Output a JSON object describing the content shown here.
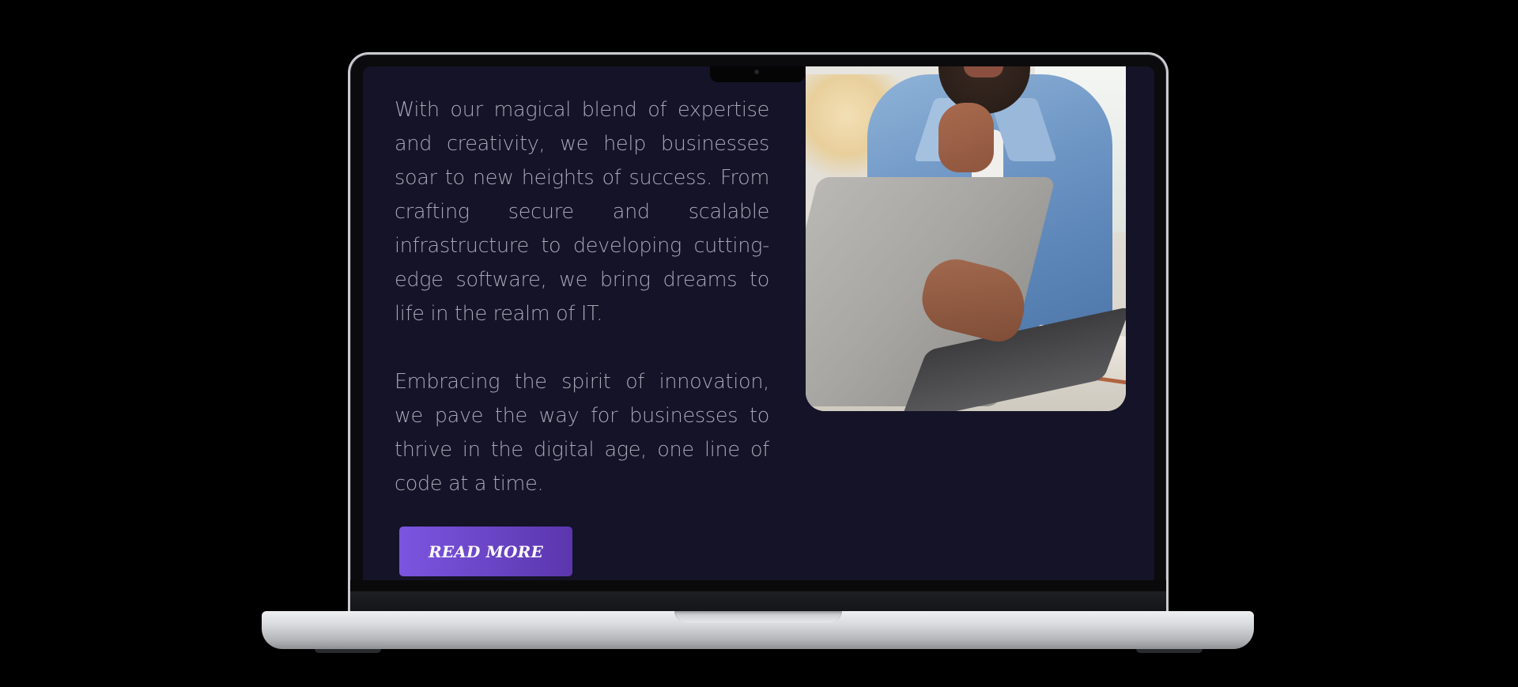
{
  "content": {
    "paragraph_1": "With our magical blend of expertise and creativity, we help businesses soar to new heights of success. From crafting secure and scalable infrastructure to developing cutting-edge software, we bring dreams to life in the realm of IT.",
    "paragraph_2": "Embracing the spirit of innovation, we pave the way for businesses to thrive in the digital age, one line of code at a time.",
    "read_more_label": "READ MORE"
  },
  "colors": {
    "page_background": "#000000",
    "screen_background": "#141327",
    "body_text": "#a7a7b6",
    "button_gradient_start": "#7b55e0",
    "button_gradient_end": "#5b36ad",
    "button_text": "#ffffff"
  },
  "image": {
    "subject": "man-in-denim-shirt-typing-on-laptop"
  }
}
